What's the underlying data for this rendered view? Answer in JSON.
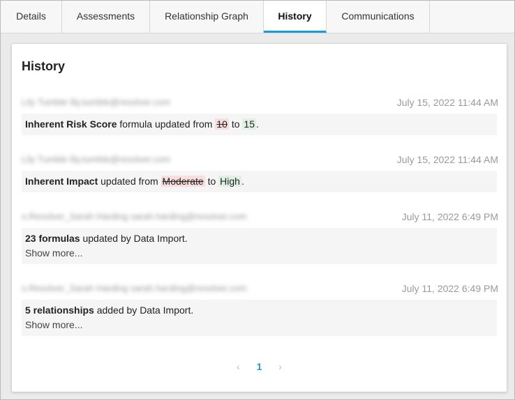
{
  "tabs": [
    {
      "label": "Details"
    },
    {
      "label": "Assessments"
    },
    {
      "label": "Relationship Graph"
    },
    {
      "label": "History"
    },
    {
      "label": "Communications"
    }
  ],
  "active_tab": "History",
  "panel": {
    "title": "History"
  },
  "entries": [
    {
      "user": "Lily Tumble lily.tumble@resolver.com",
      "timestamp": "July 15, 2022 11:44 AM",
      "field": "Inherent Risk Score",
      "text": "formula updated from",
      "old": "10",
      "to": "to",
      "new": "15",
      "end": "."
    },
    {
      "user": "Lily Tumble lily.tumble@resolver.com",
      "timestamp": "July 15, 2022 11:44 AM",
      "field": "Inherent Impact",
      "text": "updated from",
      "old": "Moderate",
      "to": "to",
      "new": "High",
      "end": "."
    },
    {
      "user": "s.Resolver_Sarah Harding sarah.harding@resolver.com",
      "timestamp": "July 11, 2022 6:49 PM",
      "field": "23 formulas",
      "text": "updated by Data Import.",
      "show_more": "Show more..."
    },
    {
      "user": "s.Resolver_Sarah Harding sarah.harding@resolver.com",
      "timestamp": "July 11, 2022 6:49 PM",
      "field": "5 relationships",
      "text": "added by Data Import.",
      "show_more": "Show more..."
    }
  ],
  "pagination": {
    "prev": "‹",
    "current": "1",
    "next": "›"
  }
}
